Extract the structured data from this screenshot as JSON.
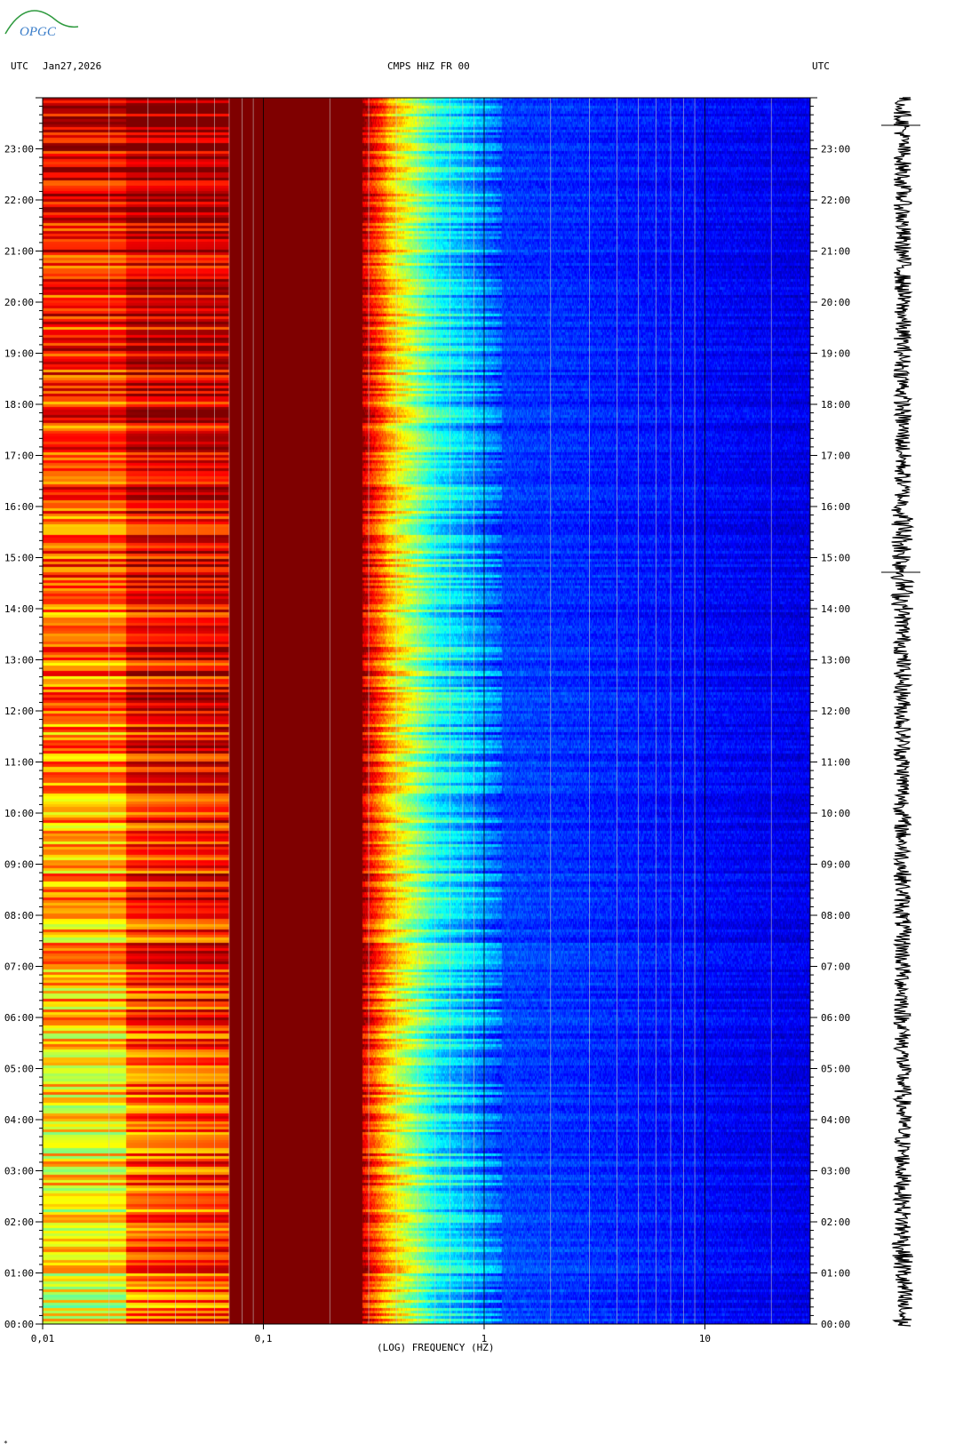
{
  "logo": {
    "text": "OPGC",
    "color": "#3a7dc9",
    "arc_color": "#2e9a3e"
  },
  "header": {
    "left_tz": "UTC",
    "date": "Jan27,2026",
    "station": "CMPS HHZ FR 00",
    "right_tz": "UTC"
  },
  "footer_mark": "*",
  "chart_data": {
    "type": "heatmap",
    "title": "CMPS HHZ FR 00",
    "xlabel": "(LOG) FREQUENCY (HZ)",
    "ylabel": "",
    "x_scale": "log",
    "xlim": [
      0.01,
      30
    ],
    "x_ticks": [
      {
        "value": 0.01,
        "label": "0,01"
      },
      {
        "value": 0.1,
        "label": "0,1"
      },
      {
        "value": 1,
        "label": "1"
      },
      {
        "value": 10,
        "label": "10"
      }
    ],
    "y_unit": "UTC hour",
    "ylim": [
      0,
      24
    ],
    "y_ticks": [
      {
        "value": 0,
        "label": "00:00"
      },
      {
        "value": 1,
        "label": "01:00"
      },
      {
        "value": 2,
        "label": "02:00"
      },
      {
        "value": 3,
        "label": "03:00"
      },
      {
        "value": 4,
        "label": "04:00"
      },
      {
        "value": 5,
        "label": "05:00"
      },
      {
        "value": 6,
        "label": "06:00"
      },
      {
        "value": 7,
        "label": "07:00"
      },
      {
        "value": 8,
        "label": "08:00"
      },
      {
        "value": 9,
        "label": "09:00"
      },
      {
        "value": 10,
        "label": "10:00"
      },
      {
        "value": 11,
        "label": "11:00"
      },
      {
        "value": 12,
        "label": "12:00"
      },
      {
        "value": 13,
        "label": "13:00"
      },
      {
        "value": 14,
        "label": "14:00"
      },
      {
        "value": 15,
        "label": "15:00"
      },
      {
        "value": 16,
        "label": "16:00"
      },
      {
        "value": 17,
        "label": "17:00"
      },
      {
        "value": 18,
        "label": "18:00"
      },
      {
        "value": 19,
        "label": "19:00"
      },
      {
        "value": 20,
        "label": "20:00"
      },
      {
        "value": 21,
        "label": "21:00"
      },
      {
        "value": 22,
        "label": "22:00"
      },
      {
        "value": 23,
        "label": "23:00"
      }
    ],
    "bands": [
      {
        "f_start": 0.01,
        "f_end": 0.024,
        "level_start_hour_0": 0.6,
        "level_end_hour_0": 0.6,
        "level_start_hour_24": 0.9,
        "level_end_hour_24": 0.9
      },
      {
        "f_start": 0.024,
        "f_end": 0.07,
        "level_start_hour_0": 0.75,
        "level_end_hour_0": 0.8,
        "level_start_hour_24": 0.95,
        "level_end_hour_24": 0.96
      },
      {
        "f_start": 0.07,
        "f_end": 0.28,
        "level_start_hour_0": 1.0,
        "level_end_hour_0": 1.0,
        "level_start_hour_24": 1.0,
        "level_end_hour_24": 1.0
      },
      {
        "f_start": 0.28,
        "f_end": 0.36,
        "level_start_hour_0": 0.92,
        "level_end_hour_0": 0.7,
        "level_start_hour_24": 0.95,
        "level_end_hour_24": 0.75
      },
      {
        "f_start": 0.36,
        "f_end": 0.6,
        "level_start_hour_0": 0.7,
        "level_end_hour_0": 0.4,
        "level_start_hour_24": 0.72,
        "level_end_hour_24": 0.4
      },
      {
        "f_start": 0.6,
        "f_end": 1.2,
        "level_start_hour_0": 0.4,
        "level_end_hour_0": 0.22,
        "level_start_hour_24": 0.4,
        "level_end_hour_24": 0.2
      },
      {
        "f_start": 1.2,
        "f_end": 30,
        "level_start_hour_0": 0.2,
        "level_end_hour_0": 0.1,
        "level_start_hour_24": 0.18,
        "level_end_hour_24": 0.1
      }
    ],
    "colormap": [
      "#00007f",
      "#0000ff",
      "#0080ff",
      "#00ffff",
      "#80ff80",
      "#ffff00",
      "#ff8000",
      "#ff0000",
      "#7f0000"
    ],
    "gridlines_hz": [
      0.02,
      0.03,
      0.04,
      0.05,
      0.06,
      0.07,
      0.08,
      0.09,
      0.1,
      0.2,
      0.3,
      0.4,
      0.5,
      0.6,
      0.7,
      0.8,
      0.9,
      1,
      2,
      3,
      4,
      5,
      6,
      7,
      8,
      9,
      10,
      20
    ],
    "seismogram": {
      "color": "#000000",
      "time_span_hours": [
        0,
        24
      ]
    },
    "grid": true,
    "legend": "none"
  }
}
